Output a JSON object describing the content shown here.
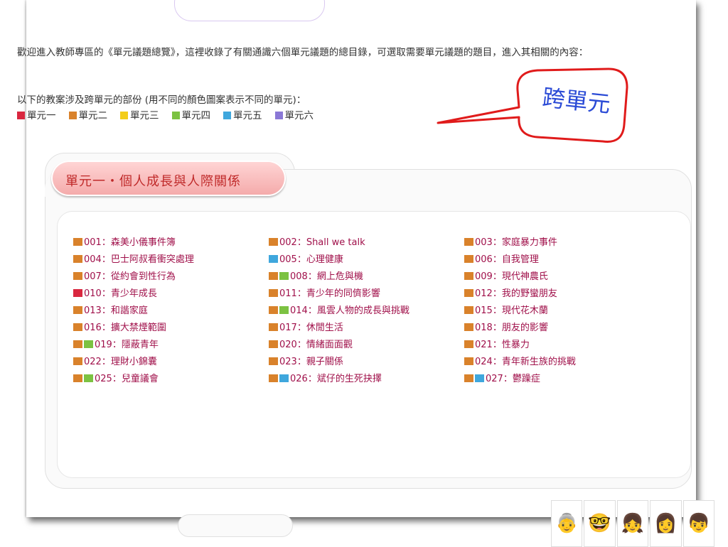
{
  "intro_text": "歡迎進入教師專區的《單元議題總覽》，這裡收錄了有關通識六個單元議題的總目錄，可選取需要單元議題的題目，進入其相關的內容：",
  "cross_unit_intro": "以下的教案涉及跨單元的部份 (用不同的顏色圖案表示不同的單元)：",
  "callout_label": "跨單元",
  "legend": [
    {
      "label": "單元一",
      "color": "#d9273f"
    },
    {
      "label": "單元二",
      "color": "#d9822b"
    },
    {
      "label": "單元三",
      "color": "#f3cd1a"
    },
    {
      "label": "單元四",
      "color": "#7cc242"
    },
    {
      "label": "單元五",
      "color": "#3fa7dd"
    },
    {
      "label": "單元六",
      "color": "#8a78d6"
    }
  ],
  "unit_title": "單元一・個人成長與人際關係",
  "lessons": [
    {
      "text": "001：森美小儀事件簿",
      "colors": [
        "#d9822b"
      ]
    },
    {
      "text": "002：Shall we talk",
      "colors": [
        "#d9822b"
      ]
    },
    {
      "text": "003：家庭暴力事件",
      "colors": [
        "#d9822b"
      ]
    },
    {
      "text": "004：巴士阿叔看衝突處理",
      "colors": [
        "#d9822b"
      ]
    },
    {
      "text": "005：心理健康",
      "colors": [
        "#3fa7dd"
      ]
    },
    {
      "text": "006：自我管理",
      "colors": [
        "#d9822b"
      ]
    },
    {
      "text": "007：從約會到性行為",
      "colors": [
        "#d9822b"
      ]
    },
    {
      "text": "008：網上危與機",
      "colors": [
        "#d9822b",
        "#7cc242"
      ]
    },
    {
      "text": "009：現代神農氏",
      "colors": [
        "#d9822b"
      ]
    },
    {
      "text": "010：青少年成長",
      "colors": [
        "#d9273f"
      ]
    },
    {
      "text": "011：青少年的同儕影響",
      "colors": [
        "#d9822b"
      ]
    },
    {
      "text": "012：我的野蠻朋友",
      "colors": [
        "#d9822b"
      ]
    },
    {
      "text": "013：和諧家庭",
      "colors": [
        "#d9822b"
      ]
    },
    {
      "text": "014：風雲人物的成長與挑戰",
      "colors": [
        "#d9822b",
        "#7cc242"
      ]
    },
    {
      "text": "015：現代花木蘭",
      "colors": [
        "#d9822b"
      ]
    },
    {
      "text": "016：擴大禁煙範圍",
      "colors": [
        "#d9822b"
      ]
    },
    {
      "text": "017：休閒生活",
      "colors": [
        "#d9822b"
      ]
    },
    {
      "text": "018：朋友的影響",
      "colors": [
        "#d9822b"
      ]
    },
    {
      "text": "019：隱蔽青年",
      "colors": [
        "#d9822b",
        "#7cc242"
      ]
    },
    {
      "text": "020：情緒面面觀",
      "colors": [
        "#d9822b"
      ]
    },
    {
      "text": "021：性暴力",
      "colors": [
        "#d9822b"
      ]
    },
    {
      "text": "022：理財小錦囊",
      "colors": [
        "#d9822b"
      ]
    },
    {
      "text": "023：親子關係",
      "colors": [
        "#d9822b"
      ]
    },
    {
      "text": "024：青年新生族的挑戰",
      "colors": [
        "#d9822b"
      ]
    },
    {
      "text": "025：兒童議會",
      "colors": [
        "#d9822b",
        "#7cc242"
      ]
    },
    {
      "text": "026：斌仔的生死抉擇",
      "colors": [
        "#d9822b",
        "#3fa7dd"
      ]
    },
    {
      "text": "027：鬱躁症",
      "colors": [
        "#d9822b",
        "#3fa7dd"
      ]
    }
  ],
  "mascot_icons": [
    "grandma-icon",
    "boy-glasses-icon",
    "girl-curly-icon",
    "woman-icon",
    "boy-spiky-icon"
  ]
}
